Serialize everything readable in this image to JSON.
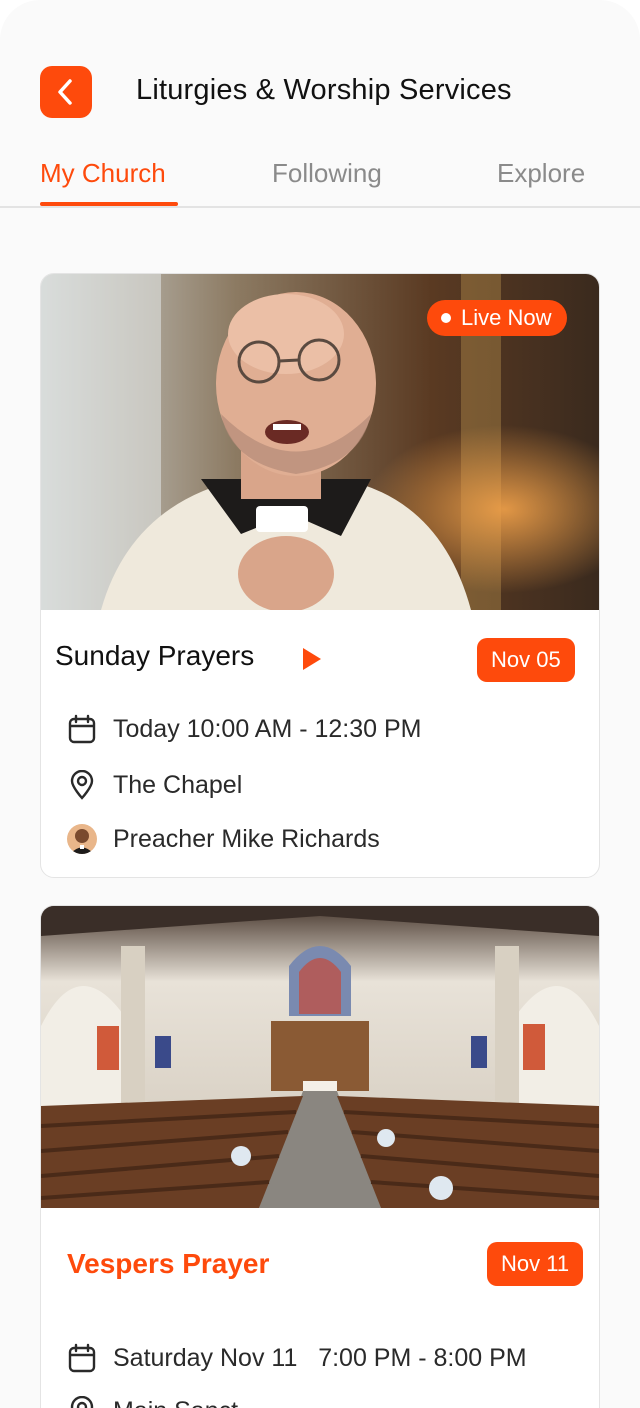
{
  "header": {
    "title": "Liturgies & Worship Services",
    "back_icon": "chevron-left-icon",
    "accent_color": "#fe4a0c"
  },
  "tabs": [
    {
      "label": "My Church",
      "active": true
    },
    {
      "label": "Following",
      "active": false
    },
    {
      "label": "Explore",
      "active": false
    }
  ],
  "services": [
    {
      "title": "Sunday Prayers",
      "status_badge": "Live Now",
      "date_badge": "Nov 05",
      "time": "Today 10:00 AM - 12:30 PM",
      "location": "The Chapel",
      "preacher": "Preacher Mike Richards",
      "image": "priest-speaking-photo"
    },
    {
      "title": "Vespers Prayer",
      "date_badge": "Nov 11",
      "time": "Saturday Nov 11   7:00 PM - 8:00 PM",
      "location": "Main Sanct...",
      "image": "church-interior-photo"
    }
  ]
}
